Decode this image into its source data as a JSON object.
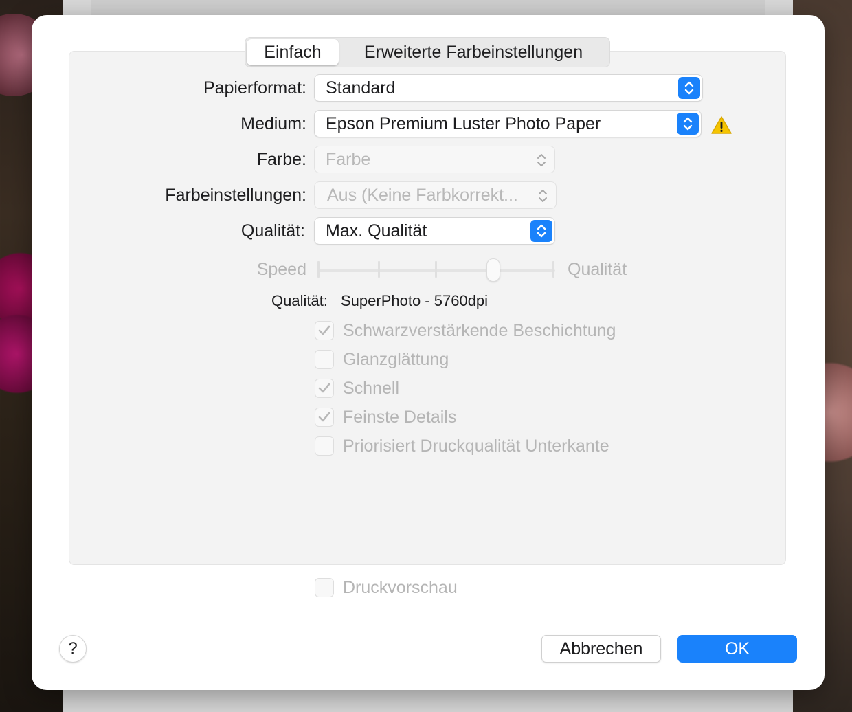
{
  "tabs": [
    "Einfach",
    "Erweiterte Farbeinstellungen"
  ],
  "form": {
    "paper_size": {
      "label": "Papierformat:",
      "value": "Standard"
    },
    "medium": {
      "label": "Medium:",
      "value": "Epson Premium Luster Photo Paper"
    },
    "color": {
      "label": "Farbe:",
      "value": "Farbe"
    },
    "color_settings": {
      "label": "Farbeinstellungen:",
      "value": "Aus (Keine Farbkorrekt..."
    },
    "quality": {
      "label": "Qualität:",
      "value": "Max. Qualität"
    }
  },
  "slider": {
    "left_label": "Speed",
    "right_label": "Qualität",
    "position": 0.75
  },
  "quality_info": {
    "label": "Qualität:",
    "value": "SuperPhoto - 5760dpi"
  },
  "options": [
    {
      "label": "Schwarzverstärkende Beschichtung",
      "checked": true
    },
    {
      "label": "Glanzglättung",
      "checked": false
    },
    {
      "label": "Schnell",
      "checked": true
    },
    {
      "label": "Feinste Details",
      "checked": true
    },
    {
      "label": "Priorisiert Druckqualität Unterkante",
      "checked": false
    }
  ],
  "preview": {
    "label": "Druckvorschau",
    "checked": false
  },
  "buttons": {
    "help": "?",
    "cancel": "Abbrechen",
    "ok": "OK"
  },
  "colors": {
    "accent": "#1a82fb",
    "warning": "#f5c400",
    "disabled_text": "#b5b5b5"
  },
  "icons": {
    "popup_arrows": "chevron-up-down-icon",
    "warning": "warning-triangle-icon",
    "check": "checkmark-icon"
  }
}
